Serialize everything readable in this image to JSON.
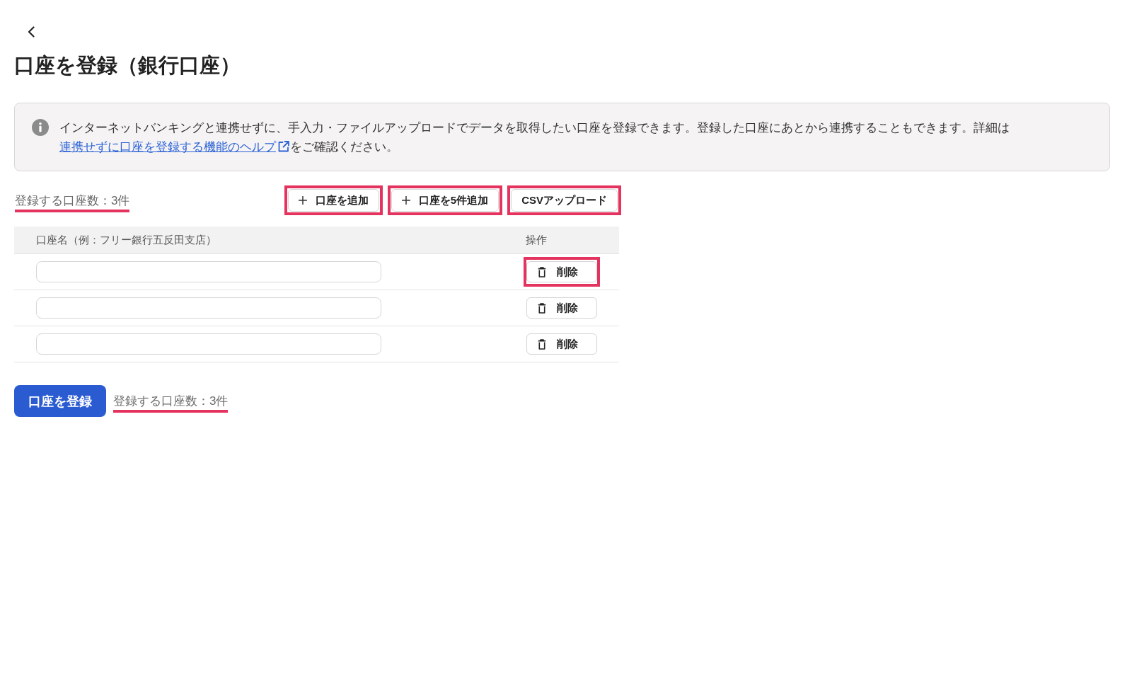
{
  "page": {
    "title": "口座を登録（銀行口座）"
  },
  "notice": {
    "text": "インターネットバンキングと連携せずに、手入力・ファイルアップロードでデータを取得したい口座を登録できます。登録した口座にあとから連携することもできます。詳細は",
    "link": "連携せずに口座を登録する機能のヘルプ",
    "text_after": "をご確認ください。"
  },
  "summary_top": {
    "text": "登録する口座数：3件",
    "highlighted": true
  },
  "actions": [
    {
      "label": "口座を追加",
      "kind": "add",
      "highlighted": true
    },
    {
      "label": "口座を5件追加",
      "kind": "add",
      "highlighted": true
    },
    {
      "label": "CSVアップロード",
      "kind": "upload",
      "highlighted": true
    }
  ],
  "table": {
    "columns": [
      "口座名（例：フリー銀行五反田支店）",
      "操作"
    ],
    "rows": [
      {
        "delete_label": "削除",
        "highlighted": true
      },
      {
        "delete_label": "削除",
        "highlighted": false
      },
      {
        "delete_label": "削除",
        "highlighted": false
      }
    ]
  },
  "submit_button": {
    "label": "口座を登録"
  },
  "summary_bottom": {
    "text": "登録する口座数：3件",
    "highlighted": true
  }
}
